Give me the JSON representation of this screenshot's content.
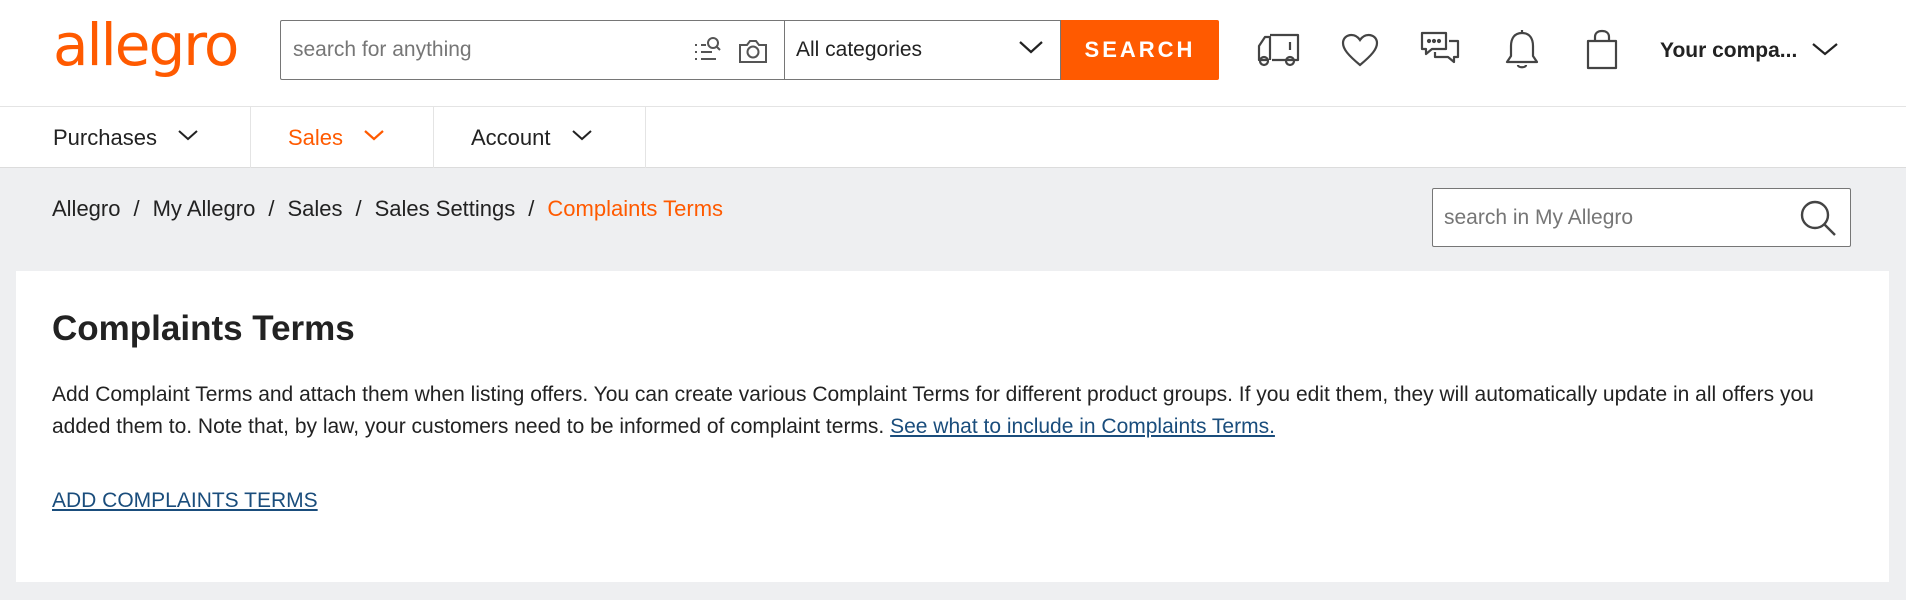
{
  "header": {
    "logo_text": "allegro",
    "search": {
      "placeholder": "search for anything",
      "value": ""
    },
    "category": {
      "selected": "All categories"
    },
    "search_button_label": "SEARCH",
    "icons": [
      "delivery-truck-icon",
      "heart-icon",
      "messages-icon",
      "bell-icon",
      "shopping-bag-icon"
    ],
    "account_label": "Your compa..."
  },
  "nav": {
    "tabs": [
      {
        "label": "Purchases",
        "active": false
      },
      {
        "label": "Sales",
        "active": true
      },
      {
        "label": "Account",
        "active": false
      }
    ]
  },
  "breadcrumb": {
    "items": [
      "Allegro",
      "My Allegro",
      "Sales",
      "Sales Settings"
    ],
    "current": "Complaints Terms",
    "separator": "/"
  },
  "my_allegro_search": {
    "placeholder": "search in My Allegro"
  },
  "main": {
    "title": "Complaints Terms",
    "description": "Add Complaint Terms and attach them when listing offers. You can create various Complaint Terms for different product groups. If you edit them, they will automatically update in all offers you added them to. Note that, by law, your customers need to be informed of complaint terms.",
    "info_link": "See what to include in Complaints Terms.",
    "add_link": "ADD COMPLAINTS TERMS"
  },
  "colors": {
    "brand": "#ff5a00",
    "link": "#1a4d7c",
    "background": "#eeeff1"
  }
}
